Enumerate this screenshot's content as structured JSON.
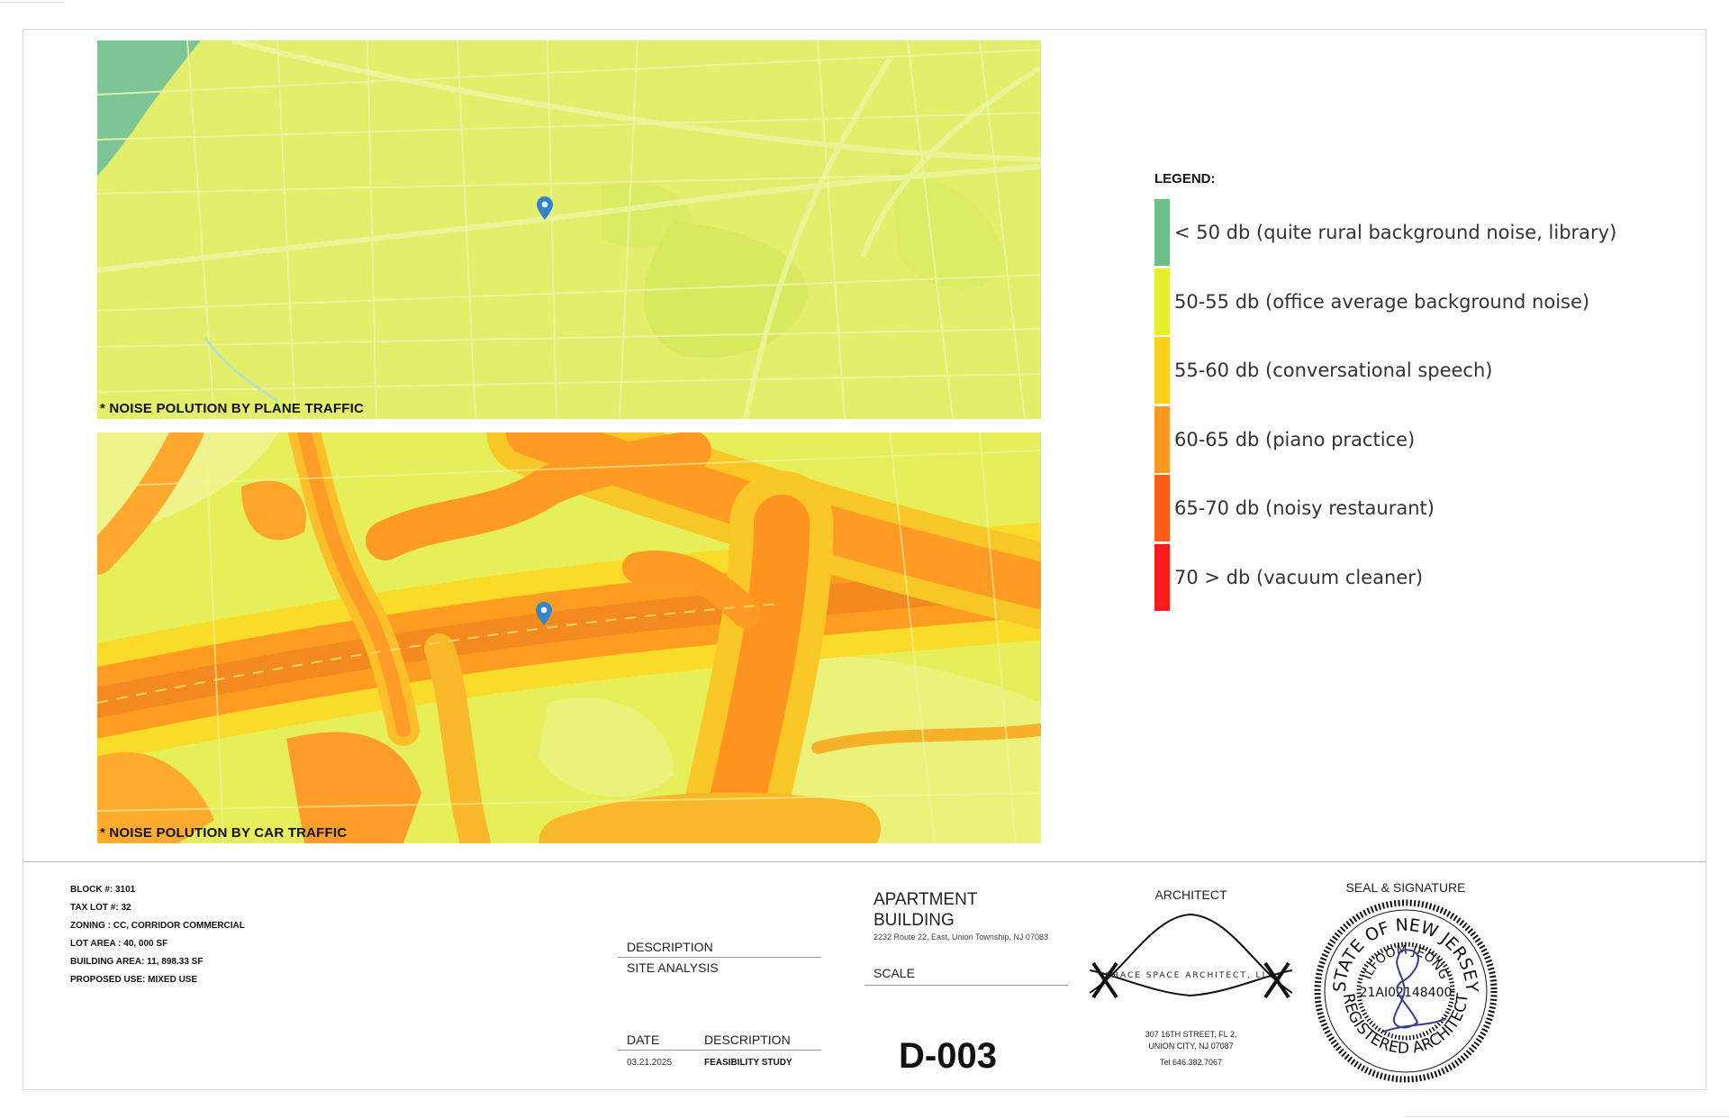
{
  "maps": {
    "plane": {
      "caption": "* NOISE POLUTION BY PLANE TRAFFIC"
    },
    "car": {
      "caption": "* NOISE POLUTION BY CAR TRAFFIC"
    },
    "marker_icon": "map-pin-icon"
  },
  "legend": {
    "title": "LEGEND:",
    "items": [
      {
        "label": "< 50 db (quite rural background noise, library)",
        "color": "#6dbf8a"
      },
      {
        "label": "50-55 db (office average background noise)",
        "color": "#e6ef2a"
      },
      {
        "label": "55-60 db (conversational speech)",
        "color": "#ffd11a"
      },
      {
        "label": "60-65 db (piano practice)",
        "color": "#ff9a1f"
      },
      {
        "label": "65-70 db (noisy restaurant)",
        "color": "#ff5a1a"
      },
      {
        "label": "70 > db (vacuum cleaner)",
        "color": "#ff1a1a"
      }
    ]
  },
  "project_info": {
    "block": "BLOCK #:  3101",
    "tax_lot": "TAX LOT #: 32",
    "zoning": "ZONING : CC, CORRIDOR COMMERCIAL",
    "lot_area": "LOT AREA : 40, 000 SF",
    "building_area": "BUILDING AREA: 11, 898.33 SF",
    "proposed_use": "PROPOSED USE: MIXED USE"
  },
  "title_block": {
    "description_label": "DESCRIPTION",
    "description_value": "SITE ANALYSIS",
    "date_label": "DATE",
    "date_desc_label": "DESCRIPTION",
    "date_value": "03.21.2025",
    "date_desc_value": "FEASIBILITY STUDY",
    "project_name": "APARTMENT BUILDING",
    "project_address": "2232 Route 22, East, Union Township, NJ 07083",
    "scale_label": "SCALE",
    "sheet_number": "D-003"
  },
  "architect": {
    "header": "ARCHITECT",
    "firm_logo_text": "GRACE SPACE ARCHITECT, LLC",
    "address_line1": "307 16TH STREET, FL 2,",
    "address_line2": "UNION CITY, NJ 07087",
    "tel": "Tel 646.382.7067"
  },
  "seal": {
    "header": "SEAL & SIGNATURE",
    "state_text": "STATE OF NEW JERSEY",
    "name_text": "ILFOOM JEONG",
    "registered_text": "REGISTERED ARCHITECT",
    "license_number": "21AI02148400"
  }
}
